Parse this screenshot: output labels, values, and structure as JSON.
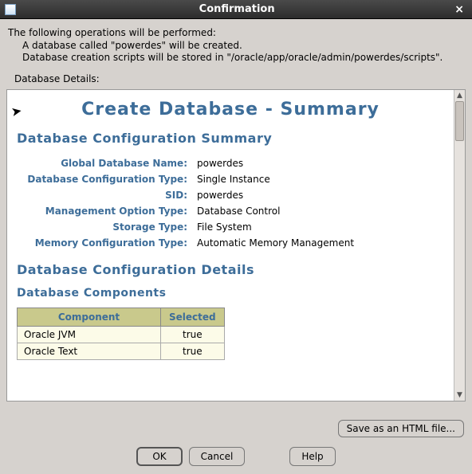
{
  "window": {
    "title": "Confirmation",
    "close_glyph": "×"
  },
  "intro": {
    "line1": "The following operations will be performed:",
    "line2": "A database called \"powerdes\" will be created.",
    "line3": "Database creation scripts will be stored in \"/oracle/app/oracle/admin/powerdes/scripts\".",
    "details_label": "Database Details:"
  },
  "summary": {
    "main_title": "Create Database - Summary",
    "section_config_title": "Database Configuration Summary",
    "rows": [
      {
        "k": "Global Database Name:",
        "v": "powerdes"
      },
      {
        "k": "Database Configuration Type:",
        "v": "Single Instance"
      },
      {
        "k": "SID:",
        "v": "powerdes"
      },
      {
        "k": "Management Option Type:",
        "v": "Database Control"
      },
      {
        "k": "Storage Type:",
        "v": "File System"
      },
      {
        "k": "Memory Configuration Type:",
        "v": "Automatic Memory Management"
      }
    ],
    "section_details_title": "Database Configuration Details",
    "components_title": "Database Components",
    "components_headers": {
      "c0": "Component",
      "c1": "Selected"
    },
    "components": [
      {
        "name": "Oracle JVM",
        "selected": "true"
      },
      {
        "name": "Oracle Text",
        "selected": "true"
      }
    ]
  },
  "buttons": {
    "save": "Save as an HTML file...",
    "ok": "OK",
    "cancel": "Cancel",
    "help": "Help"
  },
  "scroll": {
    "up": "▲",
    "down": "▼"
  }
}
